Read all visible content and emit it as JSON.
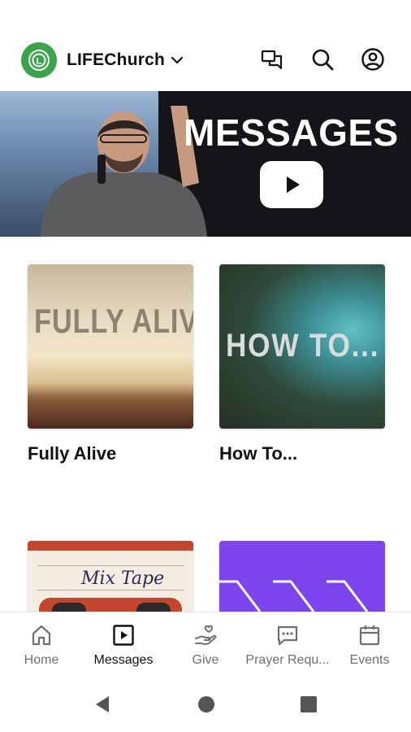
{
  "header": {
    "brand": "LIFEChurch",
    "logo_letter": "L"
  },
  "banner": {
    "title": "MESSAGES"
  },
  "cards": [
    {
      "title": "Fully Alive",
      "art_text": "FULLY ALIVE"
    },
    {
      "title": "How To...",
      "art_text": "HOW TO..."
    },
    {
      "title": "",
      "art_text": "Mix Tape"
    },
    {
      "title": "",
      "art_text": ""
    }
  ],
  "nav": {
    "items": [
      {
        "label": "Home",
        "icon": "home-icon"
      },
      {
        "label": "Messages",
        "icon": "play-box-icon",
        "active": true
      },
      {
        "label": "Give",
        "icon": "give-hand-icon"
      },
      {
        "label": "Prayer Requ...",
        "icon": "chat-dots-icon"
      },
      {
        "label": "Events",
        "icon": "calendar-icon"
      }
    ]
  },
  "colors": {
    "brand_green": "#3aa548",
    "purple_card": "#7d45f0",
    "active_text": "#111111",
    "inactive_text": "#6f6f6f"
  }
}
